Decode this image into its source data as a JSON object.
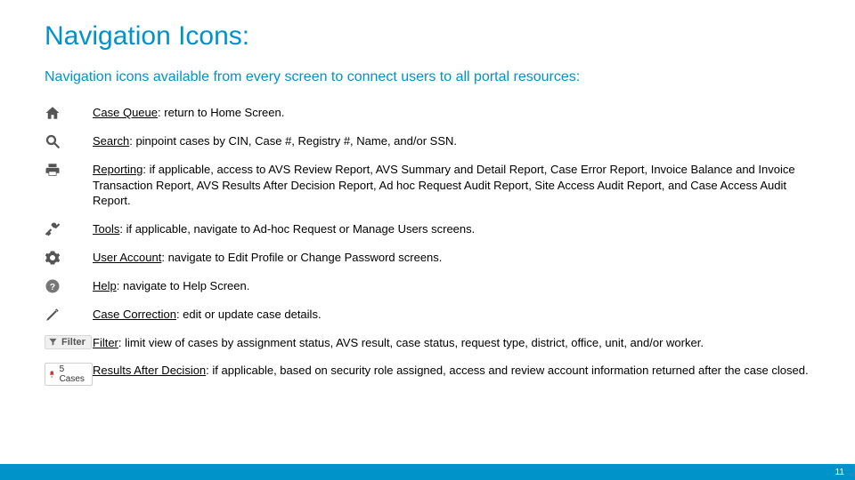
{
  "title": "Navigation Icons:",
  "subtitle": "Navigation icons available from every screen to connect users to all portal resources:",
  "items": [
    {
      "icon": "home",
      "label": "Case Queue",
      "sep": ": ",
      "desc": "return to Home Screen."
    },
    {
      "icon": "search",
      "label": "Search",
      "sep": ": ",
      "desc": "pinpoint cases by CIN, Case #, Registry #, Name, and/or SSN."
    },
    {
      "icon": "print",
      "label": "Reporting",
      "sep": ": ",
      "desc": "if applicable, access to AVS Review Report, AVS Summary and Detail Report, Case Error Report, Invoice Balance and Invoice Transaction Report, AVS Results After Decision Report, Ad hoc Request Audit Report, Site Access Audit Report, and Case Access Audit Report."
    },
    {
      "icon": "tools",
      "label": "Tools",
      "sep": ": ",
      "desc": "if applicable, navigate to Ad-hoc Request or Manage Users screens."
    },
    {
      "icon": "gear",
      "label": "User Account",
      "sep": ": ",
      "desc": "navigate to Edit Profile or Change Password screens."
    },
    {
      "icon": "help",
      "label": "Help",
      "sep": ": ",
      "desc": "navigate to Help Screen."
    },
    {
      "icon": "pencil",
      "label": "Case Correction",
      "sep": ": ",
      "desc": "edit or update case details."
    },
    {
      "icon": "filter",
      "label": "Filter",
      "sep": ": ",
      "desc": "limit view of cases by assignment status, AVS result, case status, request type, district, office, unit, and/or worker."
    },
    {
      "icon": "rad",
      "label": "Results After Decision",
      "sep": ": ",
      "desc": "if applicable, based on security role assigned, access and review account information returned after the case closed."
    }
  ],
  "filter_btn_text": "Filter",
  "rad_btn_text": "5 Cases",
  "page_number": "11"
}
